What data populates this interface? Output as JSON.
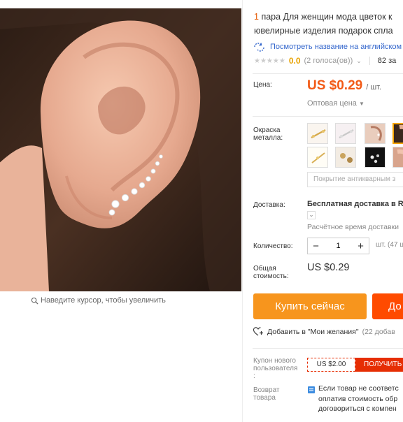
{
  "gallery": {
    "zoom_hint": "Наведите курсор, чтобы увеличить"
  },
  "product": {
    "title_qty": "1",
    "title_line1": "пара Для женщин мода цветок к",
    "title_line2": "ювелирные изделия подарок спла",
    "translate_link": "Посмотреть название на английском",
    "rating_score": "0.0",
    "rating_votes": "(2 голоса(ов))",
    "orders": "82 за"
  },
  "price": {
    "label": "Цена:",
    "amount": "US $0.29",
    "unit": "/ шт.",
    "wholesale": "Оптовая цена"
  },
  "color": {
    "label_line1": "Окраска",
    "label_line2": "металла:",
    "selected_index": 3,
    "antique_option": "Покрытие антикварным з"
  },
  "shipping": {
    "label": "Доставка:",
    "method": "Бесплатная доставка в Ru",
    "estimate": "Расчётное время доставки"
  },
  "quantity": {
    "label": "Количество:",
    "value": "1",
    "minus": "−",
    "plus": "+",
    "stock": "шт. (47 ш"
  },
  "total": {
    "label_line1": "Общая",
    "label_line2": "стоимость:",
    "value": "US $0.29"
  },
  "actions": {
    "buy_now": "Купить сейчас",
    "add_to_cart": "До",
    "wishlist": "Добавить в \"Мои желания\"",
    "wishlist_count": "(22 добав"
  },
  "coupon": {
    "label_line1": "Купон нового",
    "label_line2": "пользователя",
    "label_line3": ":",
    "value": "US $2.00",
    "get": "ПОЛУЧИТЬ"
  },
  "returns": {
    "label_line1": "Возврат",
    "label_line2": "товара",
    "line1": "Если товар не соответс",
    "line2": "оплатив стоимость обр",
    "line3": "договориться с компен"
  },
  "colors": {
    "price": "#f25a16",
    "buy": "#f7951d",
    "cart": "#ff4b00",
    "link": "#3366cc",
    "coupon": "#e62e04"
  }
}
